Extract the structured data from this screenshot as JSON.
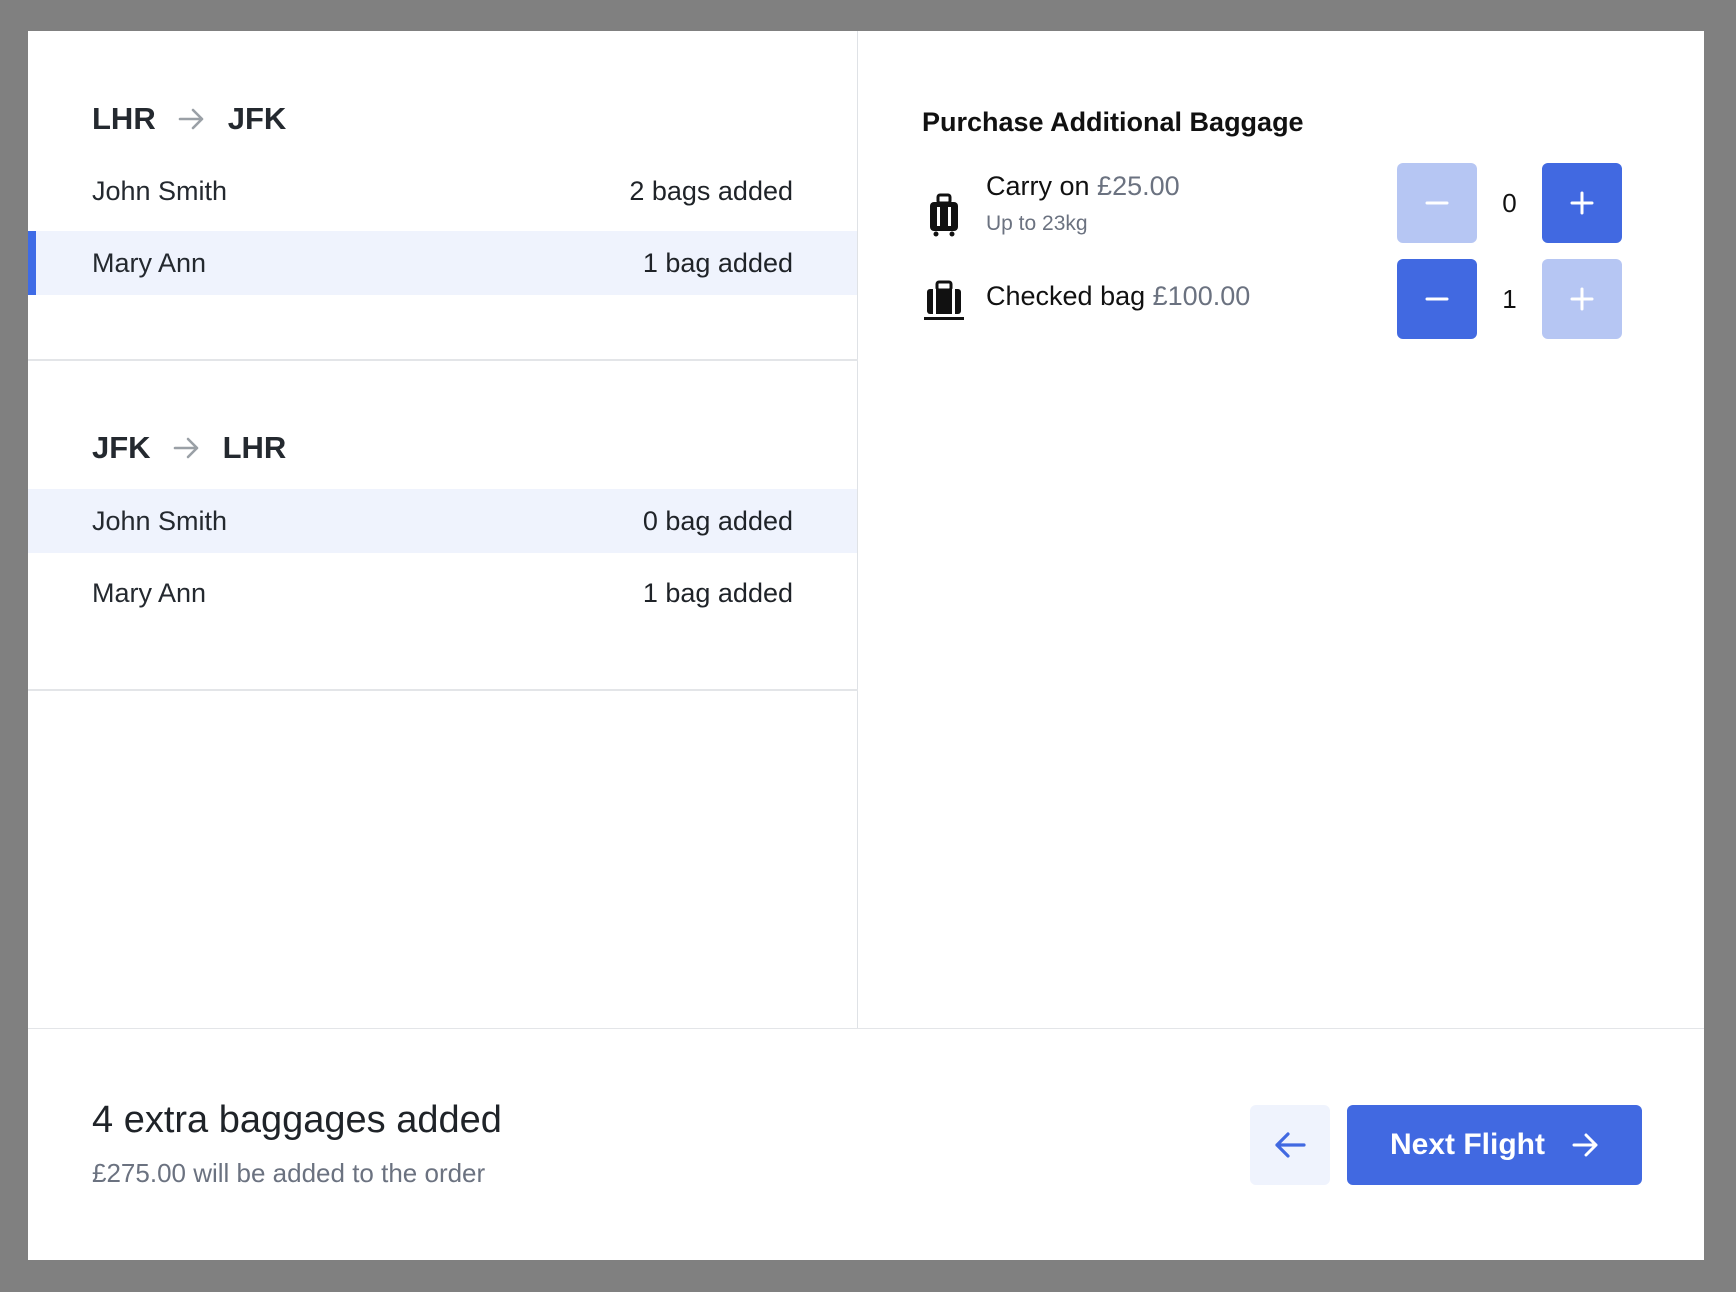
{
  "flights": [
    {
      "origin": "LHR",
      "destination": "JFK",
      "passengers": [
        {
          "name": "John Smith",
          "bags": "2 bags added"
        },
        {
          "name": "Mary Ann",
          "bags": "1 bag added"
        }
      ]
    },
    {
      "origin": "JFK",
      "destination": "LHR",
      "passengers": [
        {
          "name": "John Smith",
          "bags": "0 bag added"
        },
        {
          "name": "Mary Ann",
          "bags": "1 bag added"
        }
      ]
    }
  ],
  "panel": {
    "title": "Purchase Additional Baggage",
    "items": [
      {
        "name": "Carry on",
        "price": "£25.00",
        "sub": "Up to 23kg",
        "count": "0",
        "icon": "suitcase-icon"
      },
      {
        "name": "Checked bag",
        "price": "£100.00",
        "sub": "",
        "count": "1",
        "icon": "briefcase-icon"
      }
    ]
  },
  "summary": {
    "title": "4 extra baggages added",
    "subtitle": "£275.00 will be added to the order"
  },
  "buttons": {
    "next_label": "Next Flight"
  },
  "colors": {
    "accent": "#4169e1",
    "accent_disabled": "#b6c6f3",
    "selected_row": "#eff3fd",
    "muted_text": "#6b7280"
  }
}
